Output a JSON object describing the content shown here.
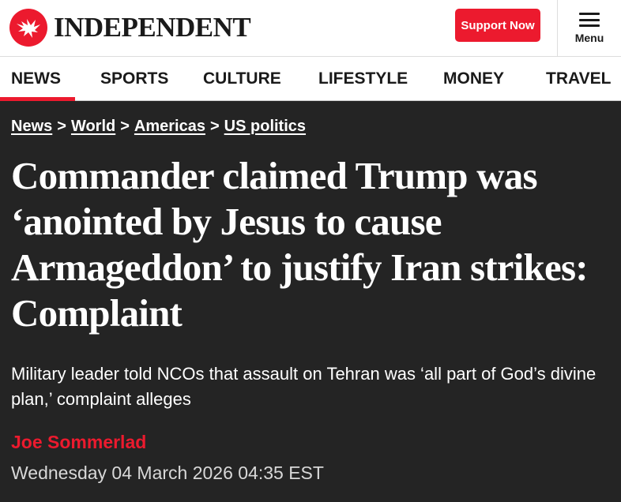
{
  "brand": {
    "name": "INDEPENDENT",
    "logo_icon": "eagle-icon",
    "accent_color": "#ec1a2e"
  },
  "header": {
    "support_label": "Support Now",
    "menu_label": "Menu",
    "menu_icon": "hamburger-icon"
  },
  "nav": {
    "items": [
      {
        "label": "NEWS",
        "active": true
      },
      {
        "label": "SPORTS"
      },
      {
        "label": "CULTURE"
      },
      {
        "label": "LIFESTYLE"
      },
      {
        "label": "MONEY"
      },
      {
        "label": "TRAVEL"
      }
    ]
  },
  "breadcrumb": {
    "items": [
      "News",
      "World",
      "Americas",
      "US politics"
    ],
    "separator": ">"
  },
  "article": {
    "headline": "Commander claimed Trump was ‘anointed by Jesus to cause Armageddon’ to justify Iran strikes: Complaint",
    "standfirst": "Military leader told NCOs that assault on Tehran was ‘all part of God’s divine plan,’ complaint alleges",
    "author": "Joe Sommerlad",
    "date": "Wednesday 04 March 2026 04:35 EST"
  }
}
